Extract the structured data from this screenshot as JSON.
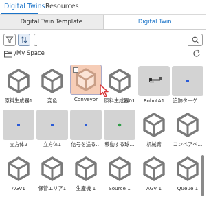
{
  "top_tabs": [
    {
      "label": "Digital Twins",
      "active": true
    },
    {
      "label": "Resources",
      "active": false
    }
  ],
  "sub_tabs": [
    {
      "label": "Digital Twin Template",
      "active": false
    },
    {
      "label": "Digital Twin",
      "active": true
    }
  ],
  "toolbar": {
    "filter_icon": "filter-icon",
    "sort_icon": "sort-icon",
    "search_placeholder": "",
    "search_icon": "search-icon"
  },
  "path": {
    "folder_icon": "folder-icon",
    "text": "/My Space",
    "refresh_icon": "refresh-icon"
  },
  "colors": {
    "accent": "#1a73c8",
    "selected_bg": "#f6cdb7",
    "cube": "#7a7a7a",
    "thumb_bg": "#d3d3d3"
  },
  "items": [
    {
      "label": "原料生成器1",
      "thumb": "cube"
    },
    {
      "label": "変色",
      "thumb": "cube"
    },
    {
      "label": "Conveyor",
      "thumb": "cube",
      "selected": true
    },
    {
      "label": "原料生成器01",
      "thumb": "cube"
    },
    {
      "label": "RobotA1",
      "thumb": "robot-photo"
    },
    {
      "label": "追跡ターゲ…",
      "thumb": "blue-dot-photo"
    },
    {
      "label": "立方体2",
      "thumb": "blue-dot-photo"
    },
    {
      "label": "立方体1",
      "thumb": "blue-dot-photo"
    },
    {
      "label": "信号を送る…",
      "thumb": "blue-dot-photo"
    },
    {
      "label": "移動する球…",
      "thumb": "green-dot-photo"
    },
    {
      "label": "机械臂",
      "thumb": "cube"
    },
    {
      "label": "コンベアベ…",
      "thumb": "cube"
    },
    {
      "label": "AGV1",
      "thumb": "cube"
    },
    {
      "label": "保管エリア1",
      "thumb": "cube"
    },
    {
      "label": "生産機 1",
      "thumb": "cube"
    },
    {
      "label": "Source 1",
      "thumb": "cube"
    },
    {
      "label": "AGV 1",
      "thumb": "cube"
    },
    {
      "label": "Queue 1",
      "thumb": "cube"
    }
  ]
}
